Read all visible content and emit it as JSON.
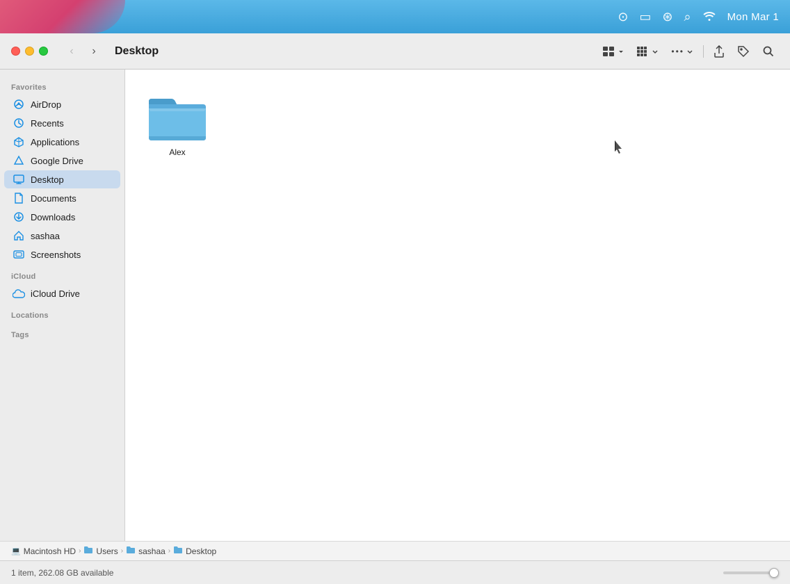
{
  "menubar": {
    "time": "Mon Mar 1",
    "icons": [
      "circle-icon",
      "battery-icon",
      "user-switch-icon",
      "search-icon",
      "wifi-icon"
    ]
  },
  "window": {
    "title": "Desktop",
    "controls": {
      "close": "●",
      "minimize": "●",
      "maximize": "●"
    }
  },
  "toolbar": {
    "back_label": "‹",
    "forward_label": "›",
    "title": "Desktop",
    "view_grid_label": "⊞",
    "view_options_label": "⊟",
    "more_label": "•••",
    "share_label": "↑",
    "tag_label": "◇",
    "search_label": "⌕"
  },
  "sidebar": {
    "favorites_header": "Favorites",
    "icloud_header": "iCloud",
    "locations_header": "Locations",
    "tags_header": "Tags",
    "items": [
      {
        "id": "airdrop",
        "label": "AirDrop",
        "icon": "airdrop"
      },
      {
        "id": "recents",
        "label": "Recents",
        "icon": "recents"
      },
      {
        "id": "applications",
        "label": "Applications",
        "icon": "applications"
      },
      {
        "id": "google-drive",
        "label": "Google Drive",
        "icon": "google-drive"
      },
      {
        "id": "desktop",
        "label": "Desktop",
        "icon": "desktop",
        "active": true
      },
      {
        "id": "documents",
        "label": "Documents",
        "icon": "documents"
      },
      {
        "id": "downloads",
        "label": "Downloads",
        "icon": "downloads"
      },
      {
        "id": "sashaa",
        "label": "sashaa",
        "icon": "home"
      },
      {
        "id": "screenshots",
        "label": "Screenshots",
        "icon": "screenshots"
      }
    ],
    "icloud_items": [
      {
        "id": "icloud-drive",
        "label": "iCloud Drive",
        "icon": "icloud"
      }
    ]
  },
  "files": [
    {
      "id": "alex-folder",
      "label": "Alex",
      "type": "folder"
    }
  ],
  "breadcrumb": [
    {
      "label": "Macintosh HD",
      "icon": "💻"
    },
    {
      "label": "Users",
      "icon": "📁"
    },
    {
      "label": "sashaa",
      "icon": "📁"
    },
    {
      "label": "Desktop",
      "icon": "📁"
    }
  ],
  "status": {
    "item_count": "1 item, 262.08 GB available"
  }
}
